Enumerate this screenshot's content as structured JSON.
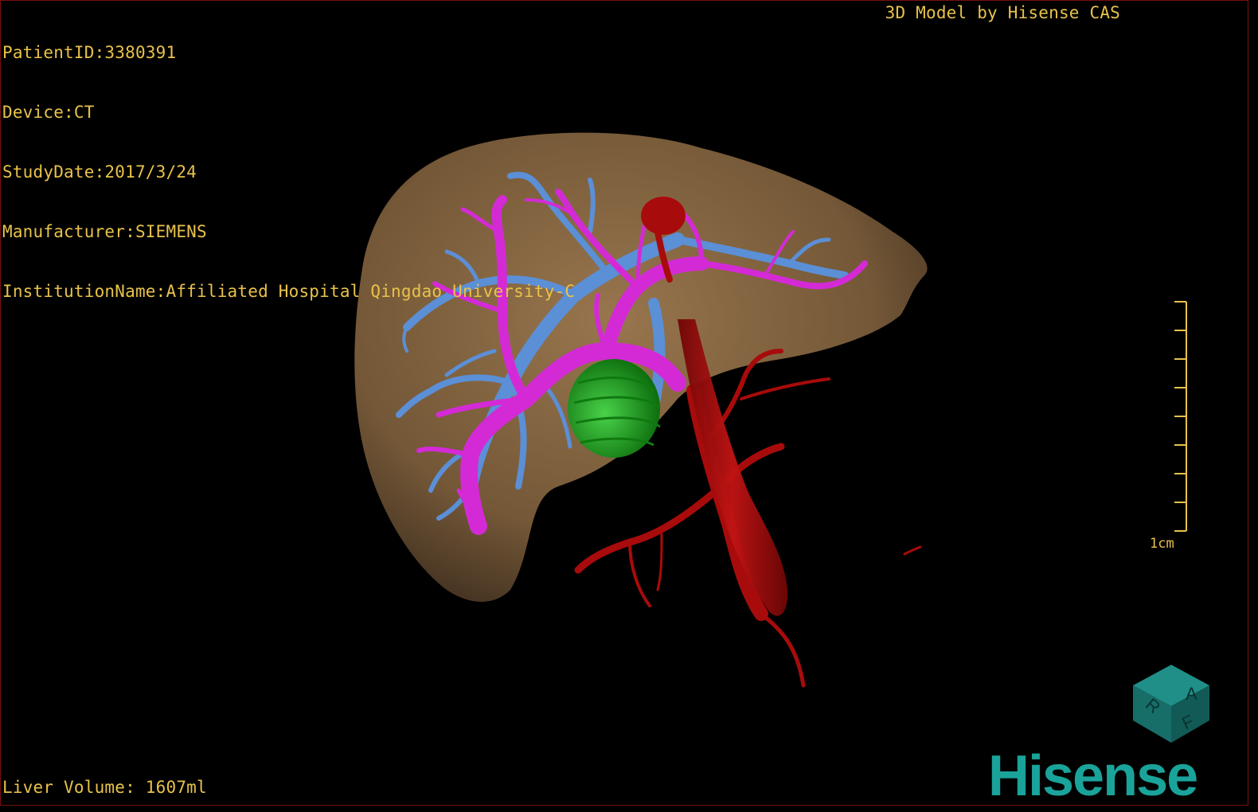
{
  "header": {
    "patient_id": "PatientID:3380391",
    "device": "Device:CT",
    "study_date": "StudyDate:2017/3/24",
    "manufacturer": "Manufacturer:SIEMENS",
    "institution": "InstitutionName:Affiliated Hospital Qingdao University-C",
    "brand_tag": "3D Model by Hisense CAS"
  },
  "footer": {
    "volume": "Liver Volume: 1607ml"
  },
  "scale_bar": {
    "label": "1cm"
  },
  "orientation_cube": {
    "faces": [
      "A",
      "R",
      "F"
    ]
  },
  "logo": {
    "text": "Hisense"
  },
  "colors": {
    "overlay_text": "#e8c24a",
    "liver": "#8a6a44",
    "portal_vein": "#d42ad6",
    "hepatic_vein": "#5b8fd6",
    "artery": "#b00c0c",
    "tumor": "#1fa31f",
    "logo": "#1aa39a"
  }
}
